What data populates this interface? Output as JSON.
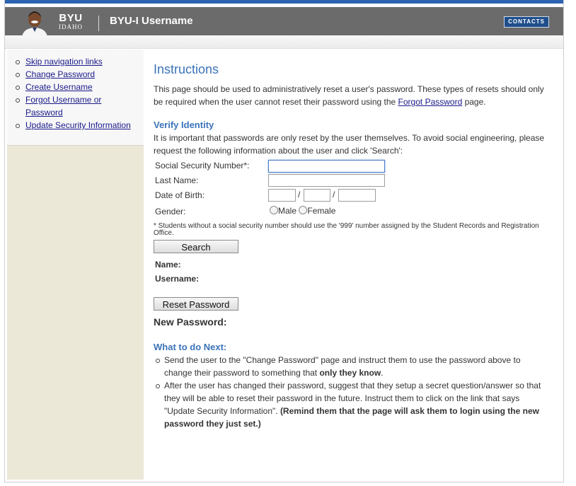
{
  "header": {
    "logo_main": "BYU",
    "logo_sub": "IDAHO",
    "app_title": "BYU-I Username",
    "contacts_label": "CONTACTS"
  },
  "sidebar": {
    "items": [
      {
        "label": "Skip navigation links"
      },
      {
        "label": "Change Password"
      },
      {
        "label": "Create Username"
      },
      {
        "label": "Forgot Username or Password"
      },
      {
        "label": "Update Security Information"
      }
    ]
  },
  "instructions": {
    "title": "Instructions",
    "text_before": "This page should be used to administratively reset a user's password. These types of resets should only be required when the user cannot reset their password using the ",
    "link": "Forgot Password",
    "text_after": " page."
  },
  "verify": {
    "title": "Verify Identity",
    "text": "It is important that passwords are only reset by the user themselves. To avoid social engineering, please request the following information about the user and click 'Search':",
    "ssn_label": "Social Security Number*:",
    "ssn_value": "",
    "lastname_label": "Last Name:",
    "lastname_value": "",
    "dob_label": "Date of Birth:",
    "dob_sep": "/",
    "gender_label": "Gender:",
    "male_label": "Male",
    "female_label": "Female",
    "note": "* Students without a social security number should use the '999' number assigned by the Student Records and Registration Office.",
    "search_label": "Search",
    "name_label": "Name:",
    "username_label": "Username:"
  },
  "reset": {
    "button_label": "Reset Password",
    "new_password_label": "New Password:"
  },
  "next": {
    "title": "What to do Next:",
    "step1_text": "Send the user to the \"Change Password\" page and instruct them to use the password above to change their password to something that ",
    "step1_bold": "only they know",
    "step1_end": ".",
    "step2_text": "After the user has changed their password, suggest that they setup a secret question/answer so that they will be able to reset their password in the future. Instruct them to click on the link that says \"Update Security Information\". ",
    "step2_bold": "(Remind them that the page will ask them to login using the new password they just set.)"
  },
  "colors": {
    "header_bg": "#6b6b6b",
    "top_strip": "#2d63b0",
    "heading_blue": "#3b73b9",
    "sidebar_bg": "#ebe8d8",
    "link": "#1a1a8a"
  }
}
